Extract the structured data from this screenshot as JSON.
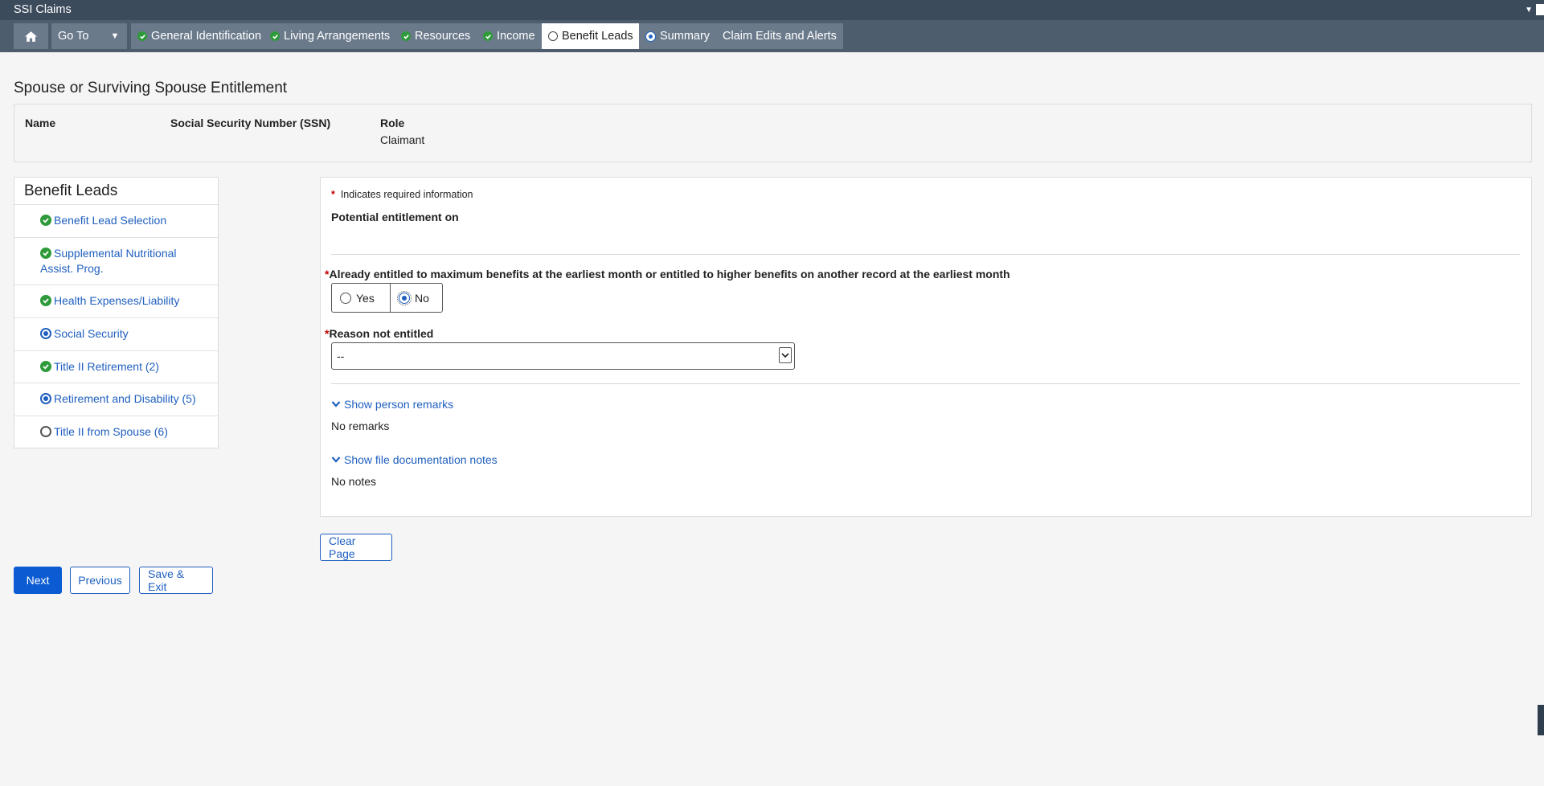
{
  "app": {
    "title": "SSI Claims"
  },
  "nav": {
    "goto_label": "Go To",
    "tabs": [
      {
        "label": "General Identification",
        "status": "complete"
      },
      {
        "label": "Living Arrangements",
        "status": "complete"
      },
      {
        "label": "Resources",
        "status": "complete"
      },
      {
        "label": "Income",
        "status": "complete"
      },
      {
        "label": "Benefit Leads",
        "status": "current"
      },
      {
        "label": "Summary",
        "status": "in-progress"
      },
      {
        "label": "Claim Edits and Alerts",
        "status": "none"
      }
    ]
  },
  "page": {
    "title": "Spouse or Surviving Spouse Entitlement"
  },
  "person": {
    "headers": {
      "name": "Name",
      "ssn": "Social Security Number (SSN)",
      "role": "Role"
    },
    "values": {
      "name": "",
      "ssn": "",
      "role": "Claimant"
    }
  },
  "sidebar": {
    "title": "Benefit Leads",
    "items": [
      {
        "label": "Benefit Lead Selection",
        "status": "complete"
      },
      {
        "label": "Supplemental Nutritional Assist. Prog.",
        "status": "complete"
      },
      {
        "label": "Health Expenses/Liability",
        "status": "complete"
      },
      {
        "label": "Social Security",
        "status": "in-progress"
      },
      {
        "label": "Title II Retirement (2)",
        "status": "complete"
      },
      {
        "label": "Retirement and Disability (5)",
        "status": "in-progress"
      },
      {
        "label": "Title II from Spouse (6)",
        "status": "not-started"
      }
    ]
  },
  "form": {
    "required_star": "*",
    "required_note": "Indicates required information",
    "potential_label": "Potential entitlement on",
    "question_label": "Already entitled to maximum benefits at the earliest month or entitled to higher benefits on another record at the earliest month",
    "options": {
      "yes": "Yes",
      "no": "No"
    },
    "selected_option": "No",
    "reason_label": "Reason not entitled",
    "reason_value": "--",
    "person_remarks_toggle": "Show person remarks",
    "person_remarks_value": "No remarks",
    "file_notes_toggle": "Show file documentation notes",
    "file_notes_value": "No notes"
  },
  "buttons": {
    "clear_page": "Clear Page",
    "next": "Next",
    "previous": "Previous",
    "save_exit": "Save & Exit"
  },
  "colors": {
    "titlebar": "#3c4b5c",
    "navbar": "#4e5d6e",
    "tab": "#6b7a8b",
    "link": "#1f5fbf",
    "primary_button": "#0b5bd3",
    "complete": "#2e9a3a",
    "required": "#c40000"
  }
}
